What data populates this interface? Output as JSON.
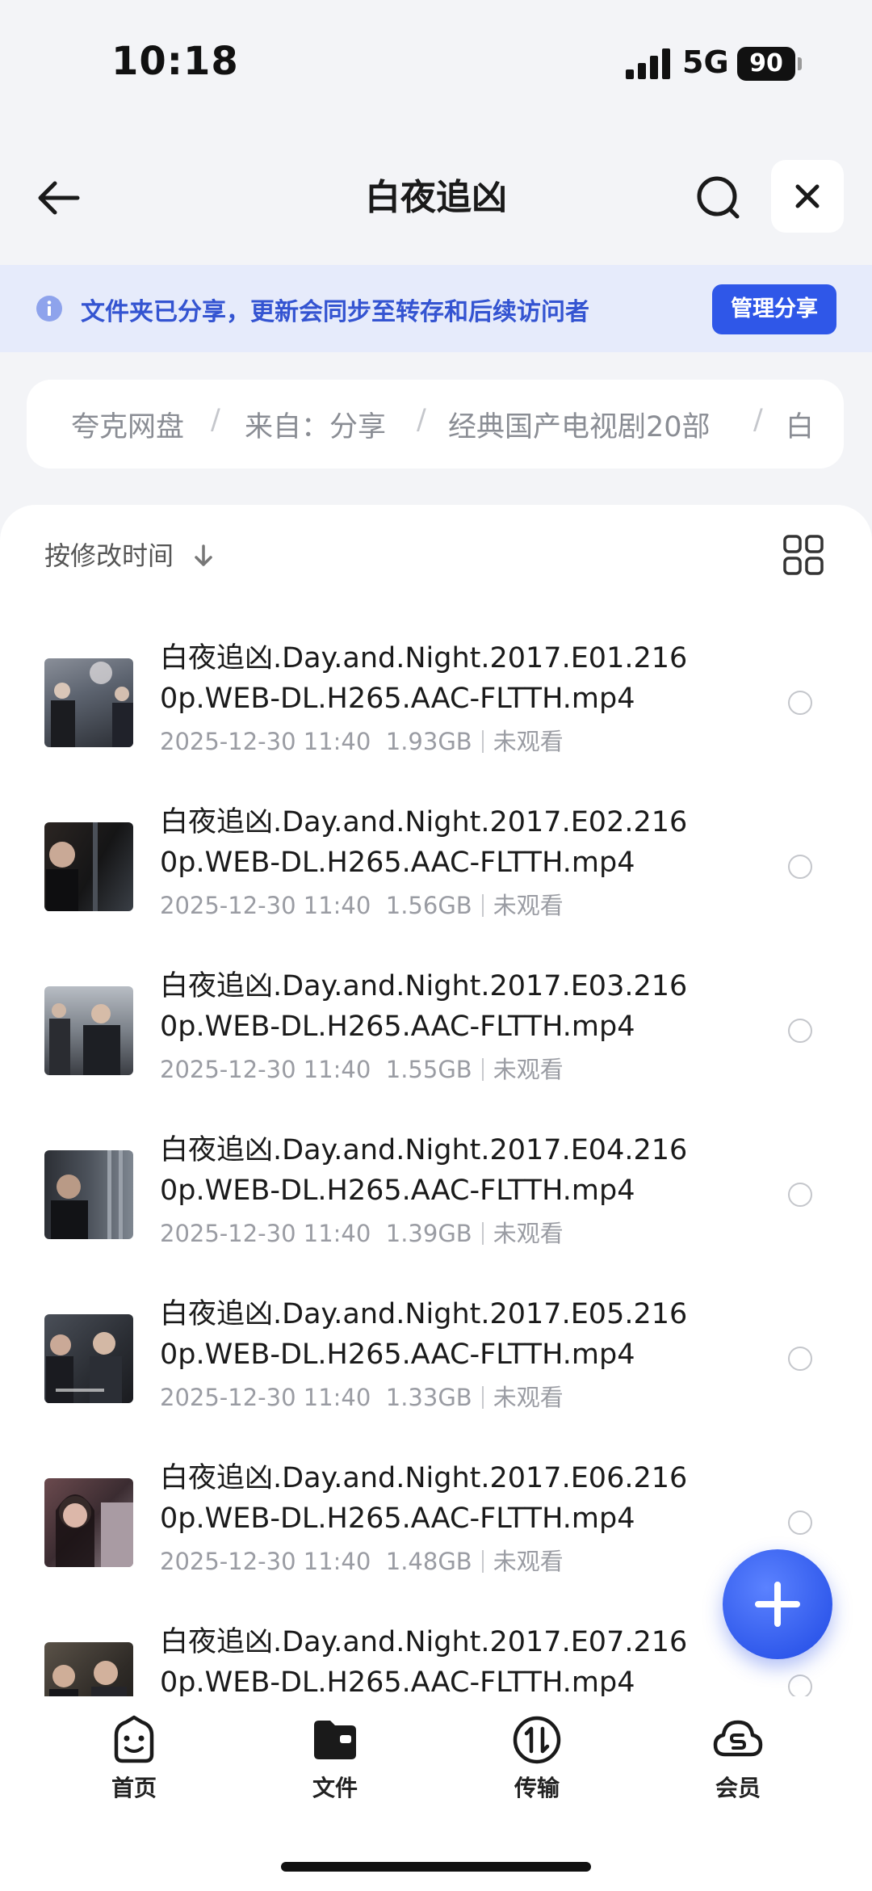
{
  "status_bar": {
    "time": "10:18",
    "network": "5G",
    "battery": "90"
  },
  "header": {
    "title": "白夜追凶"
  },
  "notice": {
    "text": "文件夹已分享，更新会同步至转存和后续访问者",
    "button": "管理分享"
  },
  "breadcrumb": {
    "items": [
      "夸克网盘",
      "来自：分享",
      "经典国产电视剧20部",
      "白"
    ]
  },
  "sort": {
    "label": "按修改时间"
  },
  "files": [
    {
      "name": "白夜追凶.Day.and.Night.2017.E01.2160p.WEB-DL.H265.AAC-FLTTH.mp4",
      "date": "2025-12-30 11:40",
      "size": "1.93GB",
      "status": "未观看"
    },
    {
      "name": "白夜追凶.Day.and.Night.2017.E02.2160p.WEB-DL.H265.AAC-FLTTH.mp4",
      "date": "2025-12-30 11:40",
      "size": "1.56GB",
      "status": "未观看"
    },
    {
      "name": "白夜追凶.Day.and.Night.2017.E03.2160p.WEB-DL.H265.AAC-FLTTH.mp4",
      "date": "2025-12-30 11:40",
      "size": "1.55GB",
      "status": "未观看"
    },
    {
      "name": "白夜追凶.Day.and.Night.2017.E04.2160p.WEB-DL.H265.AAC-FLTTH.mp4",
      "date": "2025-12-30 11:40",
      "size": "1.39GB",
      "status": "未观看"
    },
    {
      "name": "白夜追凶.Day.and.Night.2017.E05.2160p.WEB-DL.H265.AAC-FLTTH.mp4",
      "date": "2025-12-30 11:40",
      "size": "1.33GB",
      "status": "未观看"
    },
    {
      "name": "白夜追凶.Day.and.Night.2017.E06.2160p.WEB-DL.H265.AAC-FLTTH.mp4",
      "date": "2025-12-30 11:40",
      "size": "1.48GB",
      "status": "未观看"
    },
    {
      "name": "白夜追凶.Day.and.Night.2017.E07.2160p.WEB-DL.H265.AAC-FLTTH.mp4",
      "date": "",
      "size": "",
      "status": ""
    }
  ],
  "bottom_nav": [
    {
      "label": "首页",
      "icon": "home-face-icon"
    },
    {
      "label": "文件",
      "icon": "folder-icon"
    },
    {
      "label": "传输",
      "icon": "transfer-icon"
    },
    {
      "label": "会员",
      "icon": "cloud-member-icon"
    }
  ],
  "colors": {
    "accent": "#2f57e8",
    "notice_bg": "#e6ebfb",
    "notice_text": "#3454d1",
    "page_bg": "#f3f4f7"
  }
}
